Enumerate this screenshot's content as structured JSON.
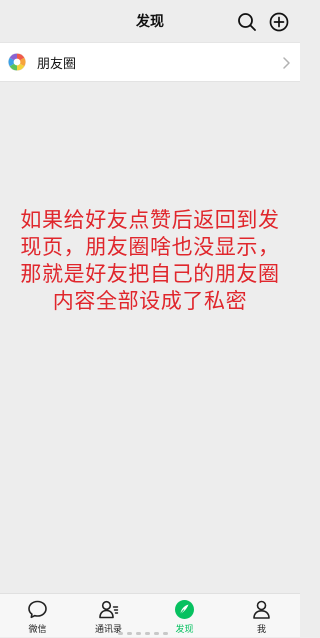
{
  "header": {
    "title": "发现"
  },
  "moments": {
    "label": "朋友圈"
  },
  "overlay": {
    "lines": [
      "如果给好友点赞后返回到发",
      "现页，朋友圈啥也没显示，",
      "那就是好友把自己的朋友圈",
      "内容全部设成了私密"
    ],
    "color": "#e0262c"
  },
  "tabbar": {
    "tabs": [
      {
        "label": "微信",
        "icon": "chat-bubble-icon",
        "active": false
      },
      {
        "label": "通讯录",
        "icon": "contacts-icon",
        "active": false
      },
      {
        "label": "发现",
        "icon": "compass-icon",
        "active": true
      },
      {
        "label": "我",
        "icon": "person-icon",
        "active": false
      }
    ],
    "active_color": "#07c160"
  }
}
